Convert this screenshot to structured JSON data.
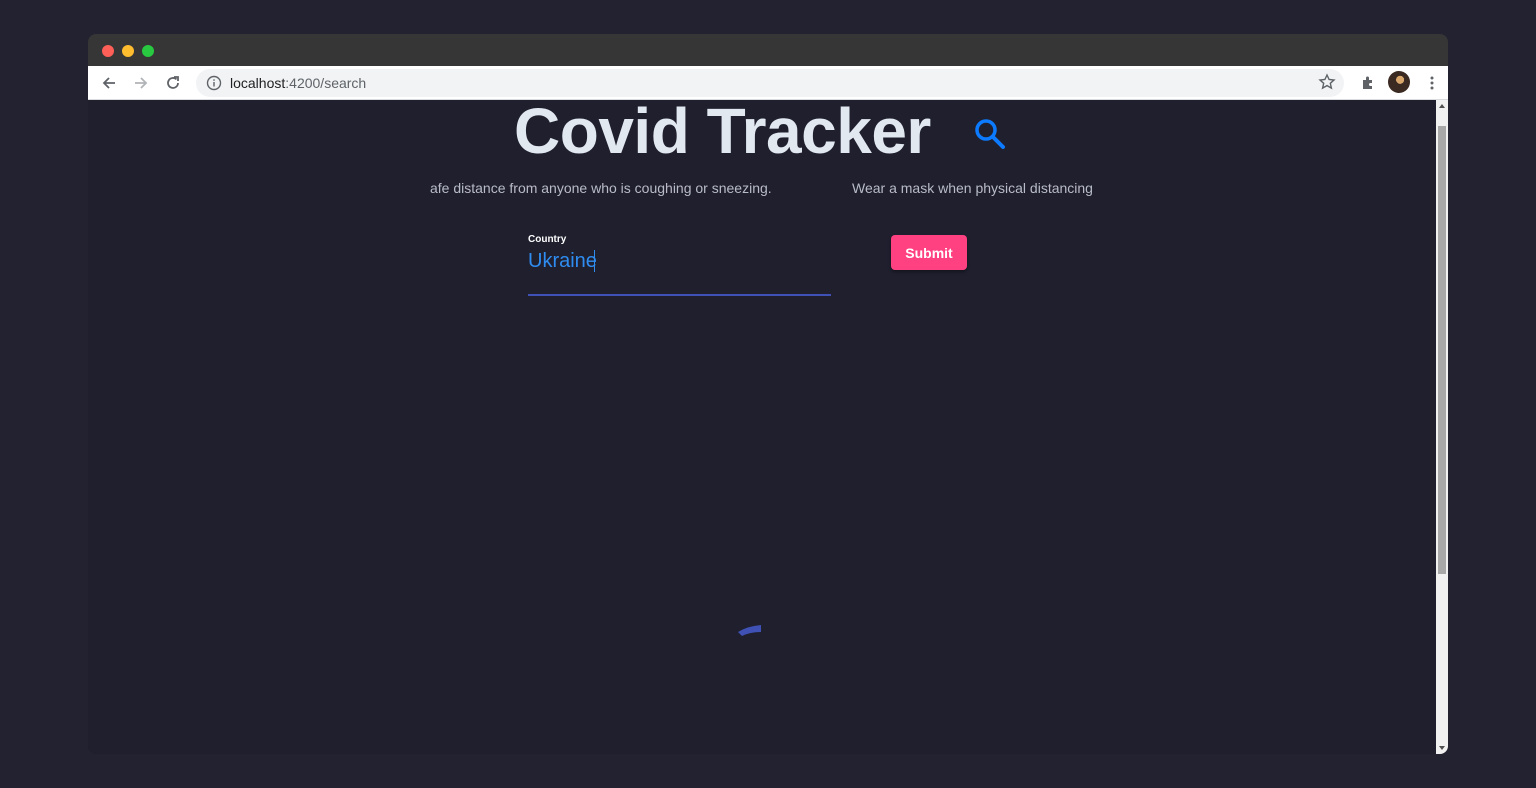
{
  "browser": {
    "url_host": "localhost",
    "url_path": ":4200/search",
    "icons": [
      "back-icon",
      "forward-icon",
      "reload-icon",
      "info-icon",
      "star-icon",
      "extensions-icon",
      "avatar",
      "kebab-menu-icon"
    ]
  },
  "page": {
    "title": "Covid Tracker",
    "tips": [
      "afe distance from anyone who is coughing or sneezing.",
      "Wear a mask when physical distancing"
    ],
    "form": {
      "country_label": "Country",
      "country_value": "Ukraine",
      "submit_label": "Submit"
    }
  },
  "colors": {
    "background": "#1f1f2e",
    "title": "#e2e8f0",
    "accent_blue": "#2f8cf0",
    "underline": "#3f51b5",
    "submit": "#ff4081"
  }
}
